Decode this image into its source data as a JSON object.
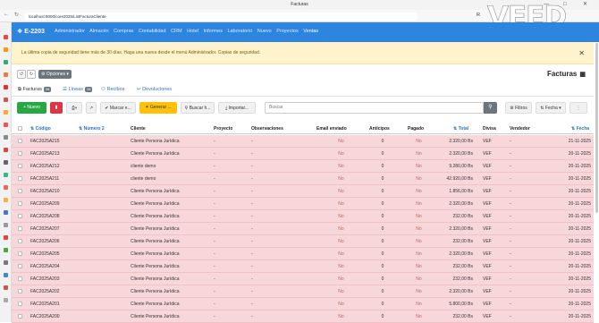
{
  "window": {
    "title": "Facturas"
  },
  "browser": {
    "url": "localhost:8000/core2025/ListFacturaCliente",
    "reader": "R"
  },
  "navbar": {
    "brand": "E-2203",
    "menu": [
      "Administrador",
      "Almacén",
      "Compras",
      "Contabilidad",
      "CRM",
      "Hotel",
      "Informes",
      "Laboratorio",
      "Nuevo",
      "Proyectos",
      "Ventas"
    ],
    "active": "Ventas"
  },
  "alert": {
    "message": "La última copia de seguridad tiene más de 30 días. Haga una nueva desde el menú Administrador. Copias de seguridad."
  },
  "toolbar": {
    "options_label": "Opciones"
  },
  "page": {
    "title": "Facturas"
  },
  "tabs": {
    "facturas": {
      "label": "Facturas",
      "count": "28"
    },
    "lineas": {
      "label": "Líneas",
      "count": "28"
    },
    "recibos": {
      "label": "Recibos"
    },
    "devoluciones": {
      "label": "Devoluciones"
    }
  },
  "actions": {
    "new": "Nuevo",
    "mark": "Marcar e...",
    "generate": "Generar ...",
    "find": "Buscar h...",
    "import": "Importar...",
    "search_placeholder": "Buscar",
    "filters": "Filtros",
    "sort": "Fecha"
  },
  "table": {
    "headers": {
      "code": "Código",
      "number2": "Número 2",
      "client": "Cliente",
      "project": "Proyecto",
      "notes": "Observaciones",
      "email": "Email enviado",
      "advances": "Anticipos",
      "paid": "Pagado",
      "total": "Total",
      "currency": "Divisa",
      "seller": "Vendedor",
      "date": "Fecha"
    },
    "rows": [
      {
        "code": "FAC2025A215",
        "number2": "",
        "client": "Cliente Persona Jurídica",
        "project": "-",
        "notes": "-",
        "email": "No",
        "advances": "0",
        "paid": "No",
        "total": "2.320,00 Bs",
        "currency": "VEF",
        "seller": "-",
        "date": "21-11-2025"
      },
      {
        "code": "FAC2025A213",
        "number2": "",
        "client": "Cliente Persona Jurídica",
        "project": "-",
        "notes": "-",
        "email": "No",
        "advances": "0",
        "paid": "No",
        "total": "2.320,00 Bs",
        "currency": "VEF",
        "seller": "-",
        "date": "20-11-2025"
      },
      {
        "code": "FAC2025A212",
        "number2": "",
        "client": "cliente demo",
        "project": "-",
        "notes": "-",
        "email": "No",
        "advances": "0",
        "paid": "No",
        "total": "9.280,00 Bs",
        "currency": "VEF",
        "seller": "-",
        "date": "20-11-2025"
      },
      {
        "code": "FAC2025A211",
        "number2": "",
        "client": "cliente demo",
        "project": "-",
        "notes": "-",
        "email": "No",
        "advances": "0",
        "paid": "No",
        "total": "42.920,00 Bs",
        "currency": "VEF",
        "seller": "-",
        "date": "20-11-2025"
      },
      {
        "code": "FAC2025A210",
        "number2": "",
        "client": "Cliente Persona Jurídica",
        "project": "-",
        "notes": "-",
        "email": "No",
        "advances": "0",
        "paid": "No",
        "total": "1.856,00 Bs",
        "currency": "VEF",
        "seller": "-",
        "date": "20-11-2025"
      },
      {
        "code": "FAC2025A209",
        "number2": "",
        "client": "Cliente Persona Jurídica",
        "project": "-",
        "notes": "-",
        "email": "No",
        "advances": "0",
        "paid": "No",
        "total": "2.320,00 Bs",
        "currency": "VEF",
        "seller": "-",
        "date": "20-11-2025"
      },
      {
        "code": "FAC2025A208",
        "number2": "",
        "client": "Cliente Persona Jurídica",
        "project": "-",
        "notes": "-",
        "email": "No",
        "advances": "0",
        "paid": "No",
        "total": "232,00 Bs",
        "currency": "VEF",
        "seller": "-",
        "date": "20-11-2025"
      },
      {
        "code": "FAC2025A207",
        "number2": "",
        "client": "Cliente Persona Jurídica",
        "project": "-",
        "notes": "-",
        "email": "No",
        "advances": "0",
        "paid": "No",
        "total": "2.320,00 Bs",
        "currency": "VEF",
        "seller": "-",
        "date": "20-11-2025"
      },
      {
        "code": "FAC2025A206",
        "number2": "",
        "client": "Cliente Persona Jurídica",
        "project": "-",
        "notes": "-",
        "email": "No",
        "advances": "0",
        "paid": "No",
        "total": "232,00 Bs",
        "currency": "VEF",
        "seller": "-",
        "date": "20-11-2025"
      },
      {
        "code": "FAC2025A205",
        "number2": "",
        "client": "Cliente Persona Jurídica",
        "project": "-",
        "notes": "-",
        "email": "No",
        "advances": "0",
        "paid": "No",
        "total": "2.320,00 Bs",
        "currency": "VEF",
        "seller": "-",
        "date": "20-11-2025"
      },
      {
        "code": "FAC2025A204",
        "number2": "",
        "client": "Cliente Persona Jurídica",
        "project": "-",
        "notes": "-",
        "email": "No",
        "advances": "0",
        "paid": "No",
        "total": "232,00 Bs",
        "currency": "VEF",
        "seller": "-",
        "date": "20-11-2025"
      },
      {
        "code": "FAC2025A203",
        "number2": "",
        "client": "Cliente Persona Jurídica",
        "project": "-",
        "notes": "-",
        "email": "No",
        "advances": "0",
        "paid": "No",
        "total": "232,00 Bs",
        "currency": "VEF",
        "seller": "-",
        "date": "20-11-2025"
      },
      {
        "code": "FAC2025A202",
        "number2": "",
        "client": "Cliente Persona Jurídica",
        "project": "-",
        "notes": "-",
        "email": "No",
        "advances": "0",
        "paid": "No",
        "total": "2.320,00 Bs",
        "currency": "VEF",
        "seller": "-",
        "date": "20-11-2025"
      },
      {
        "code": "FAC2025A201",
        "number2": "",
        "client": "Cliente Persona Jurídica",
        "project": "-",
        "notes": "-",
        "email": "No",
        "advances": "0",
        "paid": "No",
        "total": "5.800,00 Bs",
        "currency": "VEF",
        "seller": "-",
        "date": "20-11-2025"
      },
      {
        "code": "FAC2025A200",
        "number2": "",
        "client": "Cliente Persona Jurídica",
        "project": "-",
        "notes": "-",
        "email": "No",
        "advances": "0",
        "paid": "No",
        "total": "232,00 Bs",
        "currency": "VEF",
        "seller": "-",
        "date": "20-11-2025"
      }
    ]
  },
  "colors": {
    "navbar": "#2d85e0",
    "row_unpaid": "#f8d7da",
    "alert": "#fff3cd",
    "new_button": "#28a745",
    "delete_button": "#dc3545",
    "generate_button": "#ffc107"
  },
  "icons": {
    "window": "browser-window-icon",
    "search": "search-icon",
    "filters": "sliders-icon",
    "sort": "sort-icon",
    "date_sort": "sort-down-icon"
  }
}
